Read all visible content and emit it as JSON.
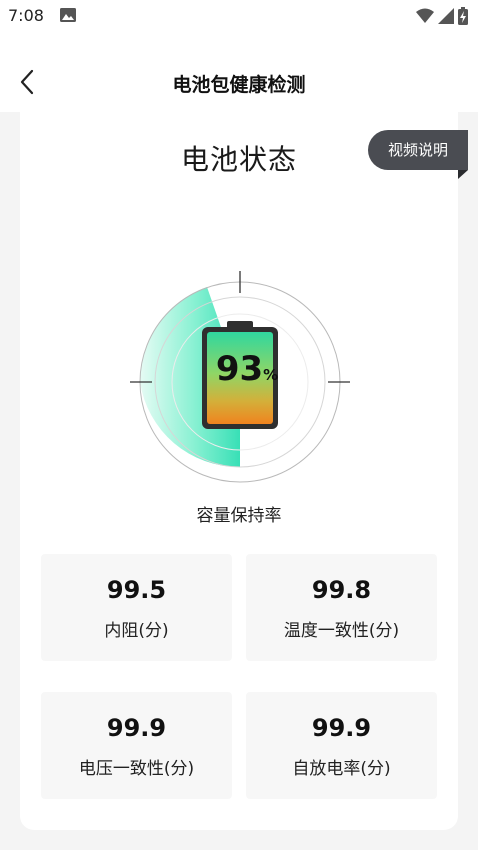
{
  "status_bar": {
    "time": "7:08"
  },
  "header": {
    "title": "电池包健康检测"
  },
  "battery_status": {
    "title": "电池状态",
    "video_button_label": "视频说明",
    "capacity_percent": 93,
    "capacity_value_text": "93",
    "capacity_unit": "%",
    "capacity_label": "容量保持率"
  },
  "metrics": [
    {
      "value": "99.5",
      "label": "内阻(分)"
    },
    {
      "value": "99.8",
      "label": "温度一致性(分)"
    },
    {
      "value": "99.9",
      "label": "电压一致性(分)"
    },
    {
      "value": "99.9",
      "label": "自放电率(分)"
    }
  ],
  "colors": {
    "accent": "#2ee0b4",
    "tag_background": "#4a4c52",
    "battery_top": "#32d6a0",
    "battery_bottom": "#f08a24"
  }
}
